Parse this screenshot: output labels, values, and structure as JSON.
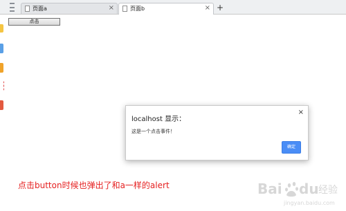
{
  "tabs": [
    {
      "title": "页面a",
      "close": "×",
      "active": false
    },
    {
      "title": "页面b",
      "close": "×",
      "active": true
    }
  ],
  "new_tab_label": "+",
  "page": {
    "button_label": "点击"
  },
  "dialog": {
    "title": "localhost 显示：",
    "close": "×",
    "message": "这是一个点击事件！",
    "ok_label": "确定"
  },
  "caption": "点击button时候也弹出了和a一样的alert",
  "watermark": {
    "brand": "Bai du",
    "suffix": "经验",
    "url": "jingyan.baidu.com"
  },
  "colors": {
    "caption": "#e52020",
    "ok_button": "#4a8df6",
    "watermark": "#d7d7d7"
  }
}
